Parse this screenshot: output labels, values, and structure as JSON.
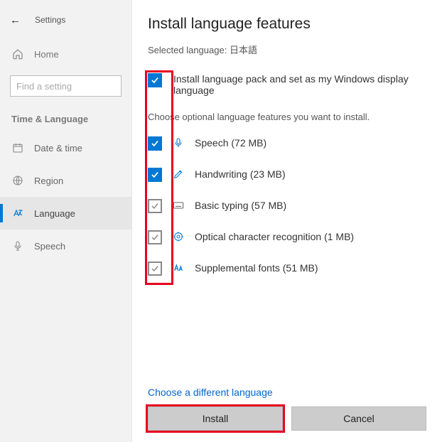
{
  "sidebar": {
    "back_title": "Settings",
    "home": "Home",
    "search_placeholder": "Find a setting",
    "section": "Time & Language",
    "items": [
      {
        "label": "Date & time"
      },
      {
        "label": "Region"
      },
      {
        "label": "Language"
      },
      {
        "label": "Speech"
      }
    ]
  },
  "main": {
    "title": "Install language features",
    "selected_prefix": "Selected language: ",
    "selected_lang": "日本語",
    "primary_option": "Install language pack and set as my Windows display language",
    "instruction": "Choose optional language features you want to install.",
    "features": [
      {
        "label": "Speech (72 MB)",
        "checked": true,
        "icon": "mic"
      },
      {
        "label": "Handwriting (23 MB)",
        "checked": true,
        "icon": "pen"
      },
      {
        "label": "Basic typing (57 MB)",
        "checked": false,
        "icon": "keyboard"
      },
      {
        "label": "Optical character recognition (1 MB)",
        "checked": false,
        "icon": "ocr"
      },
      {
        "label": "Supplemental fonts (51 MB)",
        "checked": false,
        "icon": "font"
      }
    ],
    "link": "Choose a different language",
    "install": "Install",
    "cancel": "Cancel"
  },
  "colors": {
    "accent": "#0078d4",
    "highlight": "#e6001f"
  }
}
